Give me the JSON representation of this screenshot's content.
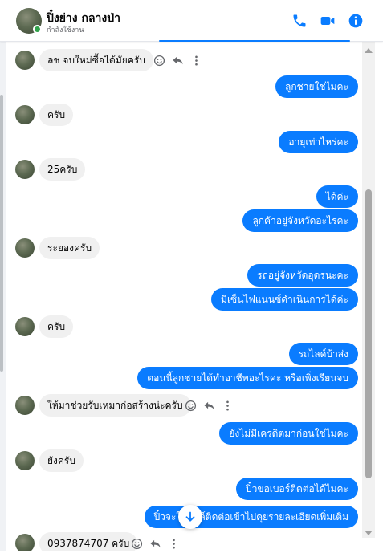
{
  "header": {
    "name": "ปิ๋งย่าง กลางป่า",
    "status": "กำลังใช้งาน",
    "icons": {
      "call": "phone-icon",
      "video": "video-camera-icon",
      "info": "info-icon"
    },
    "accent": "#0a7cff"
  },
  "messages": [
    {
      "side": "in",
      "text": "ลช จบใหม่ซื้อได้มัยครับ",
      "actions": true
    },
    {
      "side": "out",
      "text": "ลูกชายใช่ไมคะ"
    },
    {
      "side": "in",
      "text": "ครับ"
    },
    {
      "side": "out",
      "text": "อายุเท่าไหร่คะ"
    },
    {
      "side": "in",
      "text": "25ครับ"
    },
    {
      "side": "out",
      "text": "ได้ค่ะ"
    },
    {
      "side": "out",
      "text": "ลูกค้าอยู่จังหวัดอะไรคะ"
    },
    {
      "side": "in",
      "text": "ระยองครับ"
    },
    {
      "side": "out",
      "text": "รถอยู่จังหวัดอุดรนะคะ"
    },
    {
      "side": "out",
      "text": "มีเซ็นไฟแนนซ์ดำเนินการได้ค่ะ"
    },
    {
      "side": "in",
      "text": "ครับ"
    },
    {
      "side": "out",
      "text": "รถไลด์บ้าส่ง"
    },
    {
      "side": "out",
      "text": "ตอนนี้ลูกชายได้ทำอาชีพอะไรคะ หรือเพิ่งเรียนจบ"
    },
    {
      "side": "in",
      "text": "ให้มาช่วยรับเหมาก่อสร้างน่ะครับ",
      "actions": true
    },
    {
      "side": "out",
      "text": "ยังไม่มีเครดิตมาก่อนใช่ไมคะ"
    },
    {
      "side": "in",
      "text": "ยังครับ"
    },
    {
      "side": "out",
      "text": "ปิ๋วขอเบอร์ติดต่อได้ไมคะ"
    },
    {
      "side": "out",
      "text": "ปิ๋วจะให้ที่ลล์ติดต่อเข้าไปคุยรายละเอียดเพิ่มเติม"
    },
    {
      "side": "in",
      "text": "0937874707 ครับ",
      "actions": true
    }
  ],
  "colors": {
    "outgoing_bubble": "#0a7cff",
    "incoming_bubble": "#f0f0f0",
    "online": "#31a24c"
  }
}
